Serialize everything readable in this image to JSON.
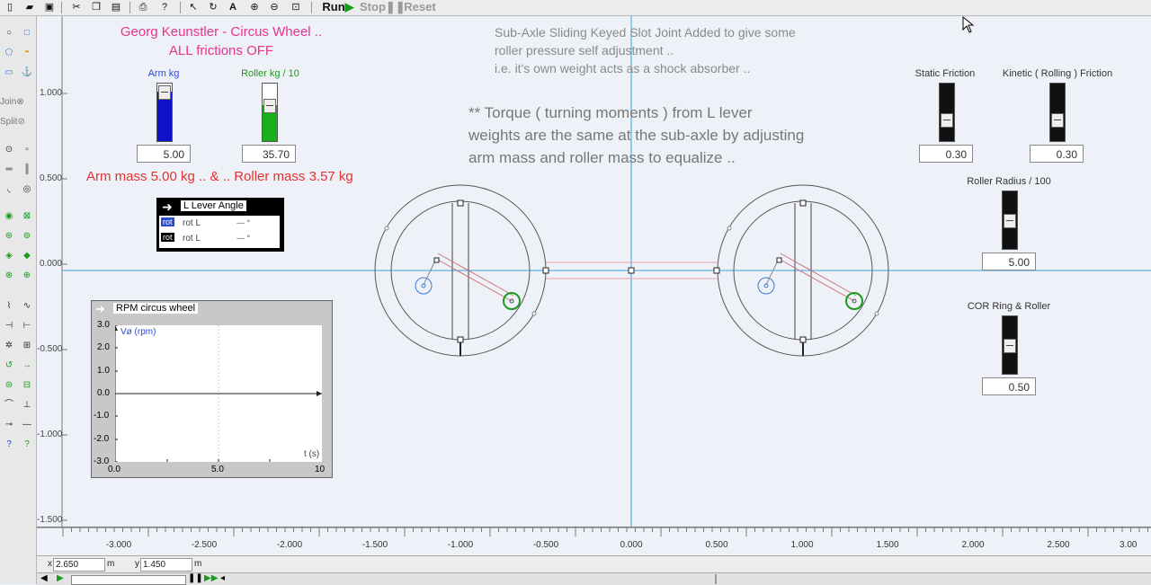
{
  "toolbar": {
    "run": "Run",
    "stop": "Stop",
    "reset": "Reset"
  },
  "palette": {
    "join": "Join",
    "split": "Split"
  },
  "title": {
    "line1": "Georg Keunstler - Circus Wheel ..",
    "line2": "ALL frictions OFF"
  },
  "note": {
    "line1": "Sub-Axle Sliding Keyed Slot Joint Added to give some",
    "line2": "roller pressure self adjustment ..",
    "line3": "i.e. it's own weight acts as a shock absorber .."
  },
  "torque": {
    "line1": "** Torque  (  turning moments )  from L lever",
    "line2": "weights are the same at the sub-axle by adjusting",
    "line3": "arm mass and roller mass to equalize .."
  },
  "arm": {
    "label": "Arm kg",
    "value": "5.00",
    "level": 0.86,
    "color": "#1010c8"
  },
  "roller": {
    "label": "Roller kg / 10",
    "value": "35.70",
    "level": 0.62,
    "color": "#18b018"
  },
  "mass_summary": "Arm mass 5.00 kg .. & .. Roller mass 3.57 kg",
  "lever_meter": {
    "title": "L Lever Angle",
    "rows": [
      {
        "tag": "rot",
        "name": "rot L",
        "value": "--- °"
      },
      {
        "tag": "rot",
        "name": "rot L",
        "value": "--- °"
      }
    ]
  },
  "static_friction": {
    "label": "Static Friction",
    "value": "0.30"
  },
  "kinetic_friction": {
    "label": "Kinetic ( Rolling ) Friction",
    "value": "0.30"
  },
  "roller_radius": {
    "label": "Roller Radius / 100",
    "value": "5.00"
  },
  "cor": {
    "label": "COR Ring & Roller",
    "value": "0.50"
  },
  "rpm_graph": {
    "title": "RPM circus wheel",
    "ylabel": "Vø (rpm)",
    "xlabel": "t (s)",
    "yticks": [
      "3.0",
      "2.0",
      "1.0",
      "0.0",
      "-1.0",
      "-2.0",
      "-3.0"
    ],
    "xticks": [
      "0.0",
      "5.0",
      "10"
    ]
  },
  "y_axis": [
    "1.000",
    "0.500",
    "0.000",
    "-0.500",
    "-1.000",
    "-1.500"
  ],
  "x_axis": [
    "-3.000",
    "-2.500",
    "-2.000",
    "-1.500",
    "-1.000",
    "-0.500",
    "0.000",
    "0.500",
    "1.000",
    "1.500",
    "2.000",
    "2.500",
    "3.00"
  ],
  "coords": {
    "x_label": "x",
    "x_value": "2.650",
    "x_unit": "m",
    "y_label": "y",
    "y_value": "1.450",
    "y_unit": "m"
  },
  "colors": {
    "canvas": "#eef2f8",
    "axis": "#3aa0d8",
    "pink": "#e8328e",
    "red": "#e83030"
  }
}
